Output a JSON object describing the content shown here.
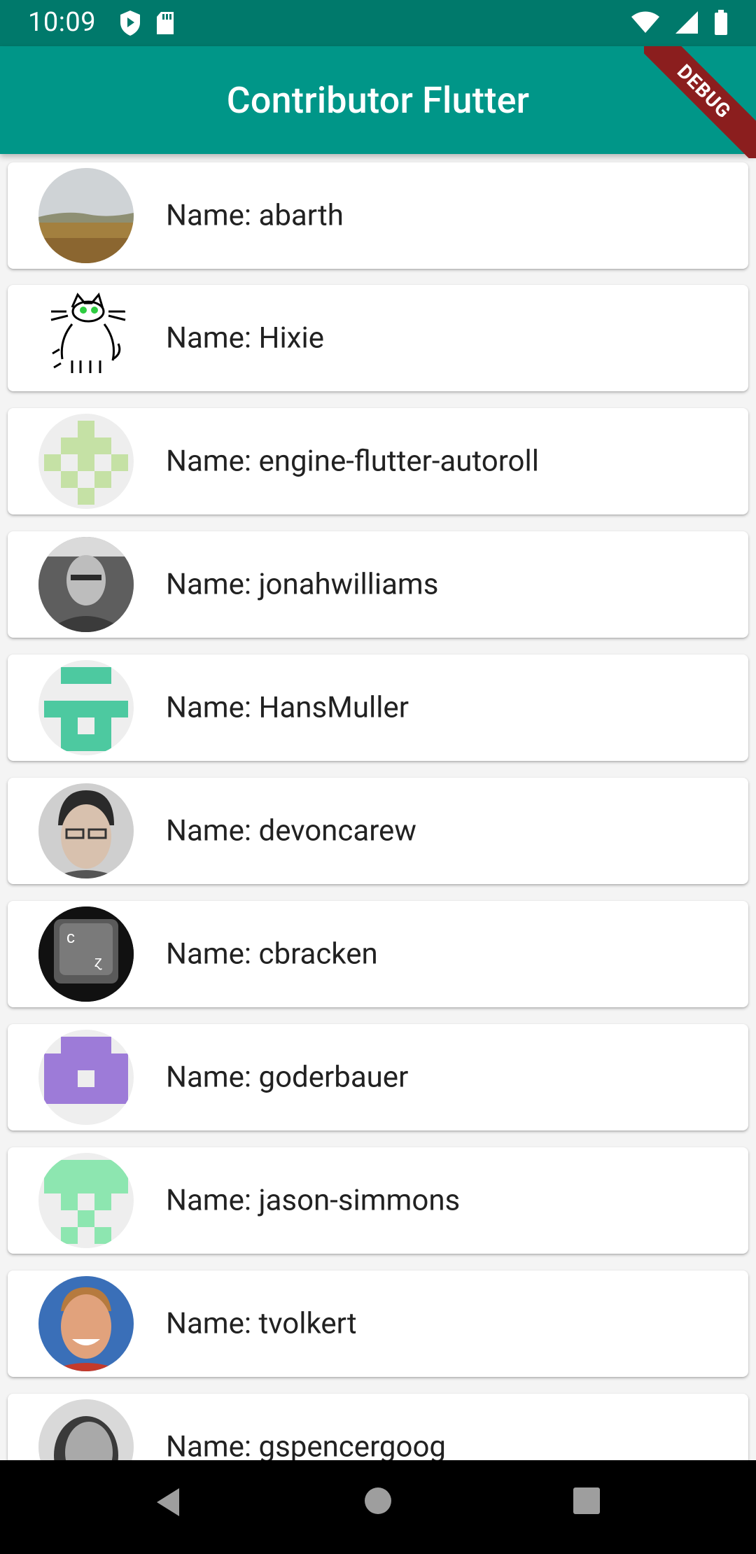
{
  "status_bar": {
    "time": "10:09",
    "icons": [
      "play-protect-icon",
      "sd-card-icon",
      "wifi-icon",
      "signal-icon",
      "battery-icon"
    ]
  },
  "app_bar": {
    "title": "Contributor Flutter"
  },
  "debug_banner": "DEBUG",
  "contributors": [
    {
      "label": "Name: abarth",
      "avatar": "landscape-photo"
    },
    {
      "label": "Name: Hixie",
      "avatar": "cat-drawing"
    },
    {
      "label": "Name: engine-flutter-autoroll",
      "avatar": "identicon-lightgreen"
    },
    {
      "label": "Name: jonahwilliams",
      "avatar": "person-photo"
    },
    {
      "label": "Name: HansMuller",
      "avatar": "identicon-teal"
    },
    {
      "label": "Name: devoncarew",
      "avatar": "person-photo"
    },
    {
      "label": "Name: cbracken",
      "avatar": "keyboard-key-photo"
    },
    {
      "label": "Name: goderbauer",
      "avatar": "identicon-purple"
    },
    {
      "label": "Name: jason-simmons",
      "avatar": "identicon-mint"
    },
    {
      "label": "Name: tvolkert",
      "avatar": "person-photo"
    },
    {
      "label": "Name: gspencergoog",
      "avatar": "person-photo"
    }
  ],
  "colors": {
    "status_bar": "#00796b",
    "app_bar": "#009688",
    "debug_banner": "#8b1e1e",
    "background": "#f4f4f4"
  },
  "nav_bar": {
    "buttons": [
      "back-icon",
      "home-icon",
      "recents-icon"
    ]
  }
}
